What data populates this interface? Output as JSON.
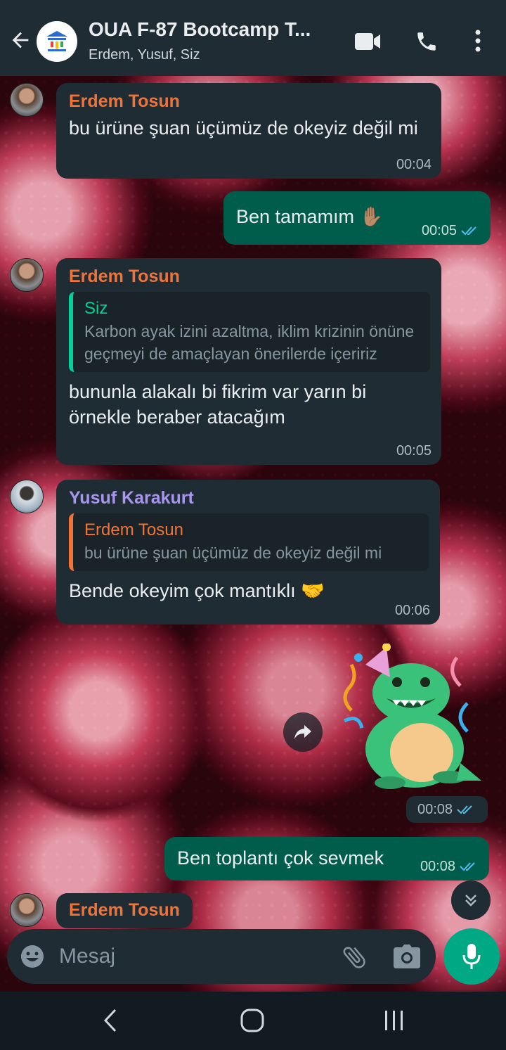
{
  "header": {
    "title": "OUA F-87 Bootcamp T...",
    "subtitle": "Erdem, Yusuf, Siz"
  },
  "colors": {
    "header_bg": "#1f2c34",
    "incoming_bubble": "#1f2c34",
    "outgoing_bubble": "#005c4b",
    "accent_green": "#00a884",
    "sender_erdem": "#f0743a",
    "sender_yusuf": "#a995f0",
    "quote_siz": "#06cf9c",
    "read_ticks": "#53bdeb"
  },
  "messages": [
    {
      "sender": "Erdem Tosun",
      "text": "bu ürüne şuan üçümüz de okeyiz değil mi",
      "time": "00:04"
    },
    {
      "text": "Ben tamamım ✋🏽",
      "time": "00:05"
    },
    {
      "sender": "Erdem Tosun",
      "quote": {
        "name": "Siz",
        "text": "Karbon ayak izini azaltma, iklim krizinin önüne geçmeyi de amaçlayan önerilerde içeririz"
      },
      "text": "bununla alakalı bi fikrim var yarın bi örnekle beraber atacağım",
      "time": "00:05"
    },
    {
      "sender": "Yusuf Karakurt",
      "quote": {
        "name": "Erdem Tosun",
        "text": "bu ürüne şuan üçümüz de okeyiz değil mi"
      },
      "text": "Bende okeyim çok mantıklı 🤝",
      "time": "00:06"
    },
    {
      "sticker": "party-dinosaur",
      "time": "00:08"
    },
    {
      "text": "Ben toplantı çok sevmek",
      "time": "00:08"
    },
    {
      "sender": "Erdem Tosun"
    }
  ],
  "input": {
    "placeholder": "Mesaj"
  },
  "icons": [
    "back-arrow-icon",
    "group-avatar",
    "video-call-icon",
    "phone-icon",
    "more-vert-icon",
    "forward-icon",
    "scroll-down-icon",
    "emoji-icon",
    "attach-icon",
    "camera-icon",
    "mic-icon",
    "nav-back-icon",
    "nav-home-icon",
    "nav-recent-icon"
  ]
}
